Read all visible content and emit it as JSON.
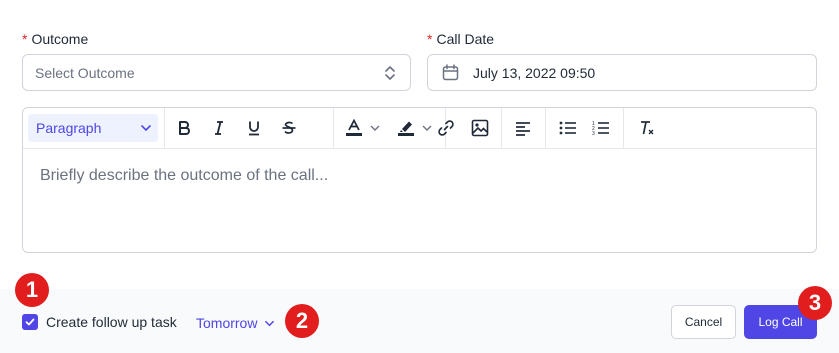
{
  "outcome": {
    "label": "Outcome",
    "required_mark": "*",
    "placeholder": "Select Outcome"
  },
  "call_date": {
    "label": "Call Date",
    "required_mark": "*",
    "value": "July 13, 2022 09:50"
  },
  "editor": {
    "format_select": "Paragraph",
    "placeholder": "Briefly describe the outcome of the call...",
    "toolbar_icons": [
      "bold-icon",
      "italic-icon",
      "underline-icon",
      "strikethrough-icon",
      "text-color-icon",
      "highlight-icon",
      "link-icon",
      "image-icon",
      "align-left-icon",
      "bullet-list-icon",
      "numbered-list-icon",
      "clear-format-icon"
    ]
  },
  "footer": {
    "follow_up_checked": true,
    "follow_up_label": "Create follow up task",
    "follow_up_when": "Tomorrow",
    "cancel_label": "Cancel",
    "log_call_label": "Log Call"
  },
  "annotations": [
    "1",
    "2",
    "3"
  ],
  "colors": {
    "accent": "#4f46e5",
    "required": "#dc2626",
    "badge": "#e11d1d"
  }
}
